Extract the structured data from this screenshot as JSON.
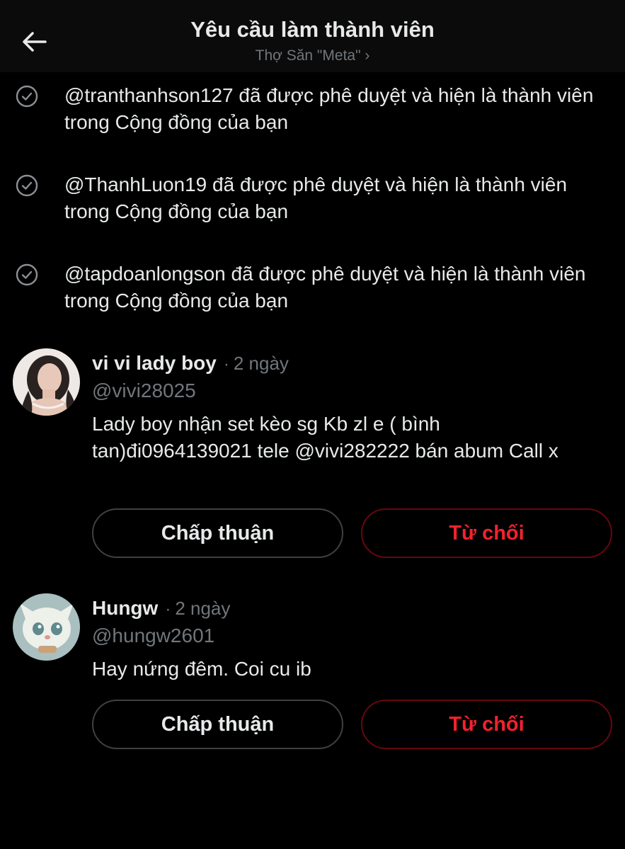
{
  "header": {
    "title": "Yêu cầu làm thành viên",
    "subtitle": "Thợ Săn \"Meta\" ›"
  },
  "notices": [
    {
      "text": "@tranthanhson127 đã được phê duyệt và hiện là thành viên trong Cộng đồng của bạn"
    },
    {
      "text": "@ThanhLuon19 đã được phê duyệt và hiện là thành viên trong Cộng đồng của bạn"
    },
    {
      "text": "@tapdoanlongson đã được phê duyệt và hiện là thành viên trong Cộng đồng của bạn"
    }
  ],
  "requests": [
    {
      "name": "vi vi lady boy",
      "separator": "·",
      "time": "2 ngày",
      "handle": "@vivi28025",
      "bio": "Lady boy nhận set kèo sg Kb zl e ( bình tan)đi0964139021 tele @vivi282222 bán abum Call x",
      "approve_label": "Chấp thuận",
      "reject_label": "Từ chối"
    },
    {
      "name": "Hungw",
      "separator": "·",
      "time": "2 ngày",
      "handle": "@hungw2601",
      "bio": "Hay nứng đêm. Coi cu ib",
      "approve_label": "Chấp thuận",
      "reject_label": "Từ chối"
    }
  ],
  "colors": {
    "background": "#000000",
    "header_background": "#0b0b0b",
    "primary_text": "#e7e9ea",
    "secondary_text": "#71767b",
    "reject_red": "#f4212e",
    "reject_border": "#67070f",
    "approve_border": "#3e4144"
  },
  "icons": {
    "back": "arrow-left-icon",
    "check": "check-circle-icon"
  }
}
